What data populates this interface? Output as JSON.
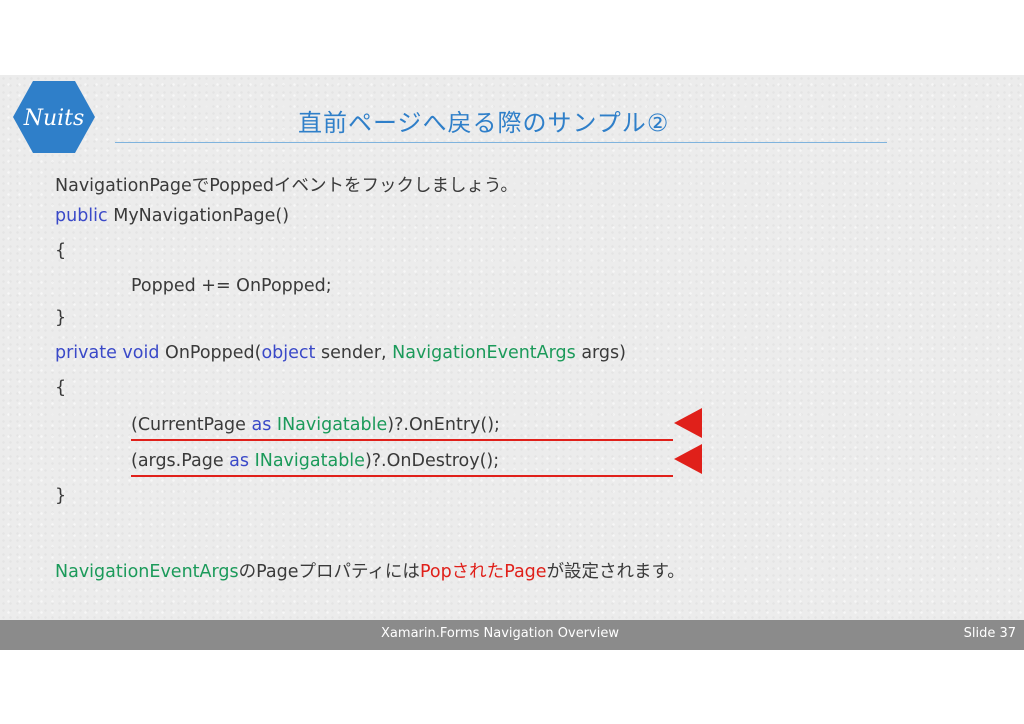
{
  "slide": {
    "title": "直前ページへ戻る際のサンプル②",
    "intro": "NavigationPageでPoppedイベントをフックしましょう。",
    "code": {
      "ctor_kw": "public",
      "ctor_rest": " MyNavigationPage()",
      "open1": "{",
      "popped_line": "Popped += OnPopped;",
      "close1": "}",
      "method_kw": "private void",
      "method_name": " OnPopped(",
      "method_obj": "object",
      "method_sender": " sender, ",
      "method_type": "NavigationEventArgs",
      "method_args": " args)",
      "open2": "{",
      "entry_pre": "(CurrentPage ",
      "entry_as": "as",
      "entry_space": " ",
      "entry_type": "INavigatable",
      "entry_post": ")?.OnEntry();",
      "destroy_pre": "(args.Page ",
      "destroy_as": "as",
      "destroy_space": " ",
      "destroy_type": "INavigatable",
      "destroy_post": ")?.OnDestroy();",
      "close2": "}"
    },
    "note": {
      "type": "NavigationEventArgs",
      "part1": "のPageプロパティには",
      "highlight": "Popされた",
      "highlight2": "Page",
      "part2": "が設定されます。"
    },
    "footer_text": "Xamarin.Forms Navigation Overview",
    "slide_number": "Slide 37"
  },
  "colors": {
    "title": "#2f7fc9",
    "keyword": "#3a49c8",
    "type": "#1b9a5a",
    "highlight": "#e0201a",
    "logo": "#2f7fc9",
    "footer": "#8b8b8b"
  },
  "icons": {
    "logo": "nuits-hexagon-logo",
    "arrow": "left-pointing-triangle-icon"
  }
}
